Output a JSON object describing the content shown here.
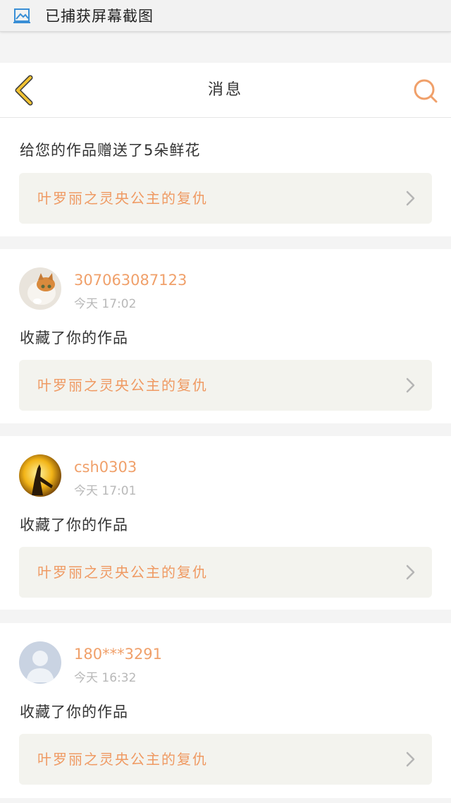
{
  "capture_bar": {
    "text": "已捕获屏幕截图",
    "icon": "screenshot-icon"
  },
  "header": {
    "title": "消息",
    "back_icon": "chevron-left-icon",
    "search_icon": "search-icon"
  },
  "colors": {
    "accent": "#f0a06a",
    "work_bg": "#f3f3ee",
    "back_arrow": "#f1c232"
  },
  "messages": [
    {
      "name": "",
      "time": "",
      "action": "给您的作品赠送了5朵鲜花",
      "work_title": "叶罗丽之灵央公主的复仇"
    },
    {
      "name": "307063087123",
      "time": "今天 17:02",
      "action": "收藏了你的作品",
      "work_title": "叶罗丽之灵央公主的复仇"
    },
    {
      "name": "csh0303",
      "time": "今天 17:01",
      "action": "收藏了你的作品",
      "work_title": "叶罗丽之灵央公主的复仇"
    },
    {
      "name": "180***3291",
      "time": "今天 16:32",
      "action": "收藏了你的作品",
      "work_title": "叶罗丽之灵央公主的复仇"
    }
  ]
}
